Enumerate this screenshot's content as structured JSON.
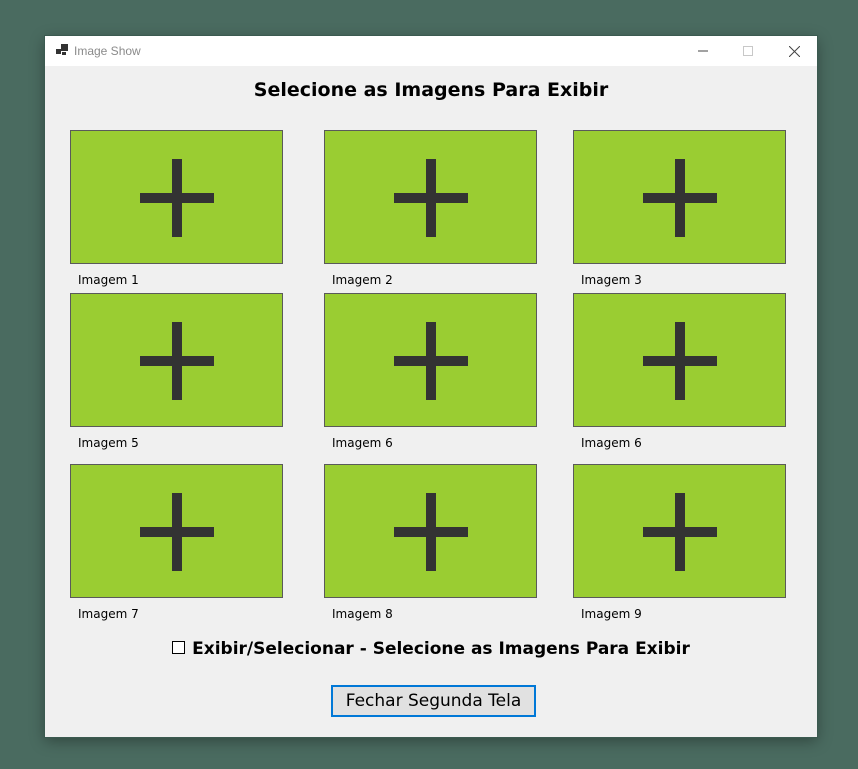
{
  "window": {
    "title": "Image Show",
    "icon": "app-window-icon",
    "controls": [
      "minimize-icon",
      "maximize-icon",
      "close-icon"
    ]
  },
  "heading": "Selecione as Imagens Para Exibir",
  "tiles": [
    {
      "label": "Imagem 1",
      "icon": "plus-icon"
    },
    {
      "label": "Imagem 2",
      "icon": "plus-icon"
    },
    {
      "label": "Imagem 3",
      "icon": "plus-icon"
    },
    {
      "label": "Imagem 5",
      "icon": "plus-icon"
    },
    {
      "label": "Imagem 6",
      "icon": "plus-icon"
    },
    {
      "label": "Imagem 6",
      "icon": "plus-icon"
    },
    {
      "label": "Imagem 7",
      "icon": "plus-icon"
    },
    {
      "label": "Imagem 8",
      "icon": "plus-icon"
    },
    {
      "label": "Imagem 9",
      "icon": "plus-icon"
    }
  ],
  "checkbox": {
    "label": "Exibir/Selecionar - Selecione as Imagens Para Exibir",
    "checked": false
  },
  "close_button": {
    "label": "Fechar Segunda Tela"
  },
  "colors": {
    "desktop": "#4a6b60",
    "tile_fill": "#9acd32",
    "plus": "#333333",
    "button_border": "#0078d7"
  }
}
